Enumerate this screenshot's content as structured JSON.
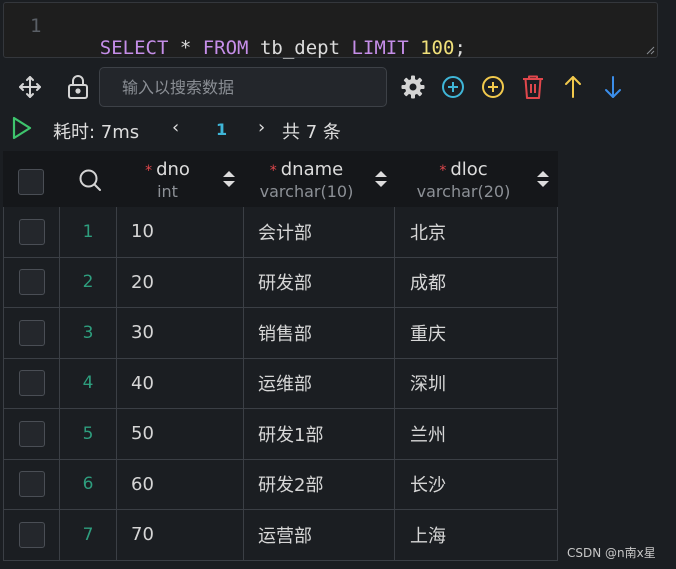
{
  "editor": {
    "line_number": "1",
    "tokens": [
      {
        "text": "SELECT",
        "kind": "kw"
      },
      {
        "text": " * ",
        "kind": "ident"
      },
      {
        "text": "FROM",
        "kind": "kw"
      },
      {
        "text": " tb_dept ",
        "kind": "ident"
      },
      {
        "text": "LIMIT",
        "kind": "kw"
      },
      {
        "text": " ",
        "kind": "ident"
      },
      {
        "text": "100",
        "kind": "num"
      },
      {
        "text": ";",
        "kind": "ident"
      }
    ]
  },
  "toolbar": {
    "search_placeholder": "输入以搜索数据",
    "icons": [
      "move-icon",
      "lock-icon",
      "gear-icon",
      "add-row-icon",
      "insert-row-icon",
      "delete-icon",
      "arrow-up-icon",
      "arrow-down-icon"
    ]
  },
  "status": {
    "elapsed": "耗时: 7ms",
    "prev": "‹",
    "page": "1",
    "next": "›",
    "total": "共 7 条"
  },
  "table": {
    "required_mark": "*",
    "columns": [
      {
        "name": "dno",
        "type": "int"
      },
      {
        "name": "dname",
        "type": "varchar(10)"
      },
      {
        "name": "dloc",
        "type": "varchar(20)"
      }
    ],
    "rows": [
      {
        "index": "1",
        "dno": "10",
        "dname": "会计部",
        "dloc": "北京"
      },
      {
        "index": "2",
        "dno": "20",
        "dname": "研发部",
        "dloc": "成都"
      },
      {
        "index": "3",
        "dno": "30",
        "dname": "销售部",
        "dloc": "重庆"
      },
      {
        "index": "4",
        "dno": "40",
        "dname": "运维部",
        "dloc": "深圳"
      },
      {
        "index": "5",
        "dno": "50",
        "dname": "研发1部",
        "dloc": "兰州"
      },
      {
        "index": "6",
        "dno": "60",
        "dname": "研发2部",
        "dloc": "长沙"
      },
      {
        "index": "7",
        "dno": "70",
        "dname": "运营部",
        "dloc": "上海"
      }
    ]
  },
  "watermark": "CSDN @n南x星",
  "colors": {
    "keyword": "#c58ee8",
    "number": "#f0e07a",
    "add": "#3fb6d8",
    "insert": "#f2c94c",
    "delete": "#e0474c",
    "up": "#f2c94c",
    "down": "#3b8eea",
    "run": "#3ec46d",
    "row_index": "#2e9e7e"
  }
}
